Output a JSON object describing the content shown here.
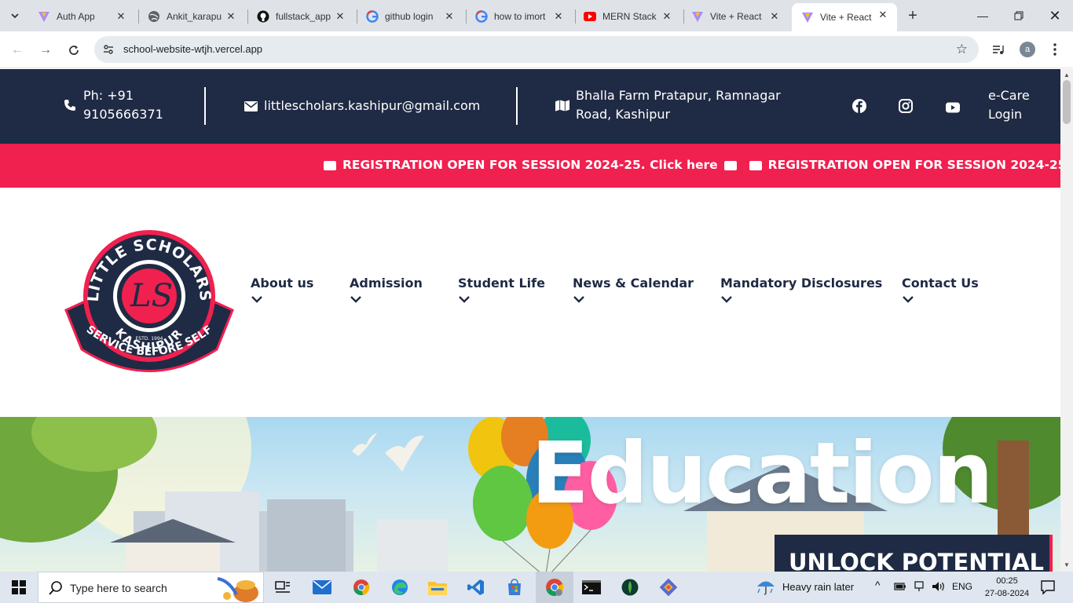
{
  "browser": {
    "tabs": [
      {
        "label": "Auth App",
        "icon": "vite-icon"
      },
      {
        "label": "Ankit_karapu",
        "icon": "globe-icon"
      },
      {
        "label": "fullstack_app",
        "icon": "github-icon"
      },
      {
        "label": "github login",
        "icon": "google-icon"
      },
      {
        "label": "how to imort",
        "icon": "google-icon"
      },
      {
        "label": "MERN Stack",
        "icon": "youtube-icon"
      },
      {
        "label": "Vite + React",
        "icon": "vite-icon"
      },
      {
        "label": "Vite + React",
        "icon": "vite-icon",
        "active": true
      }
    ],
    "url": "school-website-wtjh.vercel.app",
    "profile_initial": "a"
  },
  "topbar": {
    "phone": "Ph: +91 9105666371",
    "phone_line1": "Ph: +91",
    "phone_line2": "9105666371",
    "email": "littlescholars.kashipur@gmail.com",
    "address_line1": "Bhalla Farm Pratapur, Ramnagar",
    "address_line2": "Road, Kashipur",
    "ecare_line1": "e-Care",
    "ecare_line2": "Login"
  },
  "ticker": {
    "text": "REGISTRATION OPEN FOR SESSION 2024-25. Click here",
    "color": "#f0204f"
  },
  "logo": {
    "top_text": "LITTLE SCHOLARS",
    "monogram": "LS",
    "estd": "ESTD. 1994",
    "city": "KASHIPUR",
    "motto": "SERVICE BEFORE SELF"
  },
  "nav": {
    "items": [
      {
        "label": "About us"
      },
      {
        "label": "Admission"
      },
      {
        "label": "Student Life"
      },
      {
        "label": "News & Calendar"
      },
      {
        "label": "Mandatory Disclosures"
      },
      {
        "label": "Contact Us"
      }
    ]
  },
  "hero": {
    "title": "Education",
    "badge": "UNLOCK POTENTIAL"
  },
  "taskbar": {
    "search_placeholder": "Type here to search",
    "weather": "Heavy rain later",
    "language": "ENG",
    "time": "00:25",
    "date": "27-08-2024"
  },
  "colors": {
    "navy": "#1f2a44",
    "accent": "#f0204f"
  }
}
